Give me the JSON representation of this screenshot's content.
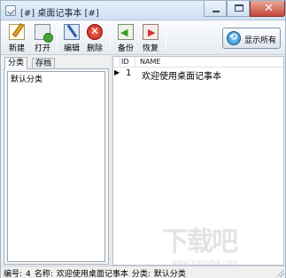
{
  "window": {
    "title": "[#] 桌面记事本 [#]"
  },
  "toolbar": {
    "buttons": [
      {
        "label": "新建",
        "icon": "new-note-icon"
      },
      {
        "label": "打开",
        "icon": "open-icon"
      },
      {
        "label": "编辑",
        "icon": "edit-icon"
      },
      {
        "label": "删除",
        "icon": "delete-icon"
      },
      {
        "label": "备份",
        "icon": "backup-icon"
      },
      {
        "label": "恢复",
        "icon": "restore-icon"
      }
    ],
    "show_all_label": "显示所有"
  },
  "left_panel": {
    "tabs": [
      {
        "label": "分类",
        "active": true
      },
      {
        "label": "存档",
        "active": false
      }
    ],
    "categories": [
      "默认分类"
    ]
  },
  "list": {
    "columns": [
      "ID",
      "NAME"
    ],
    "rows": [
      {
        "id": "1",
        "name": "欢迎使用桌面记事本",
        "selected": true
      }
    ]
  },
  "status_bar": {
    "number_label": "编号:",
    "number_value": "4",
    "name_label": "名称:",
    "name_value": "欢迎使用桌面记事本",
    "category_label": "分类:",
    "category_value": "默认分类"
  },
  "watermark": {
    "text": "下载吧",
    "sub": "www.xiazaiba.com"
  },
  "colors": {
    "title_gradient_top": "#e4eef9",
    "close_button": "#c5463a",
    "panel_border": "#a7b1bd"
  }
}
